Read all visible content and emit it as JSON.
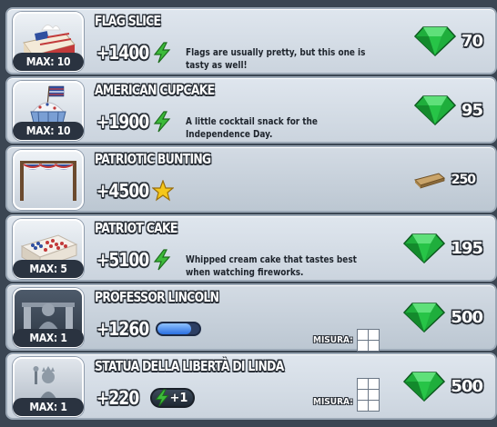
{
  "items": [
    {
      "title": "FLAG SLICE",
      "max": "MAX: 10",
      "reward": "+1400",
      "reward_icon": "lightning-bolt-icon",
      "description": "Flags are usually pretty, but this one is tasty as well!",
      "cost": "70",
      "cost_icon": "emerald-gem-icon"
    },
    {
      "title": "AMERICAN CUPCAKE",
      "max": "MAX: 10",
      "reward": "+1900",
      "reward_icon": "lightning-bolt-icon",
      "description": "A little cocktail snack for the Independence Day.",
      "cost": "95",
      "cost_icon": "emerald-gem-icon"
    },
    {
      "title": "PATRIOTIC BUNTING",
      "reward": "+4500",
      "reward_icon": "star-icon",
      "cost": "250",
      "cost_icon": "wood-plank-icon"
    },
    {
      "title": "PATRIOT CAKE",
      "max": "MAX: 5",
      "reward": "+5100",
      "reward_icon": "lightning-bolt-icon",
      "description": "Whipped cream cake that tastes best when watching fireworks.",
      "cost": "195",
      "cost_icon": "emerald-gem-icon"
    },
    {
      "title": "PROFESSOR LINCOLN",
      "max": "MAX: 1",
      "reward": "+1260",
      "reward_icon": "energy-bar-icon",
      "energy_level": 0.8,
      "size_label": "MISURA:",
      "cost": "500",
      "cost_icon": "emerald-gem-icon"
    },
    {
      "title": "STATUA DELLA LIBERTÀ DI LINDA",
      "max": "MAX: 1",
      "reward": "+220",
      "reward_icon": "lightning-bolt-icon",
      "bolt_bonus": "+1",
      "size_label": "MISURA:",
      "cost": "500",
      "cost_icon": "emerald-gem-icon"
    }
  ],
  "colors": {
    "gem_green": "#1fae3c",
    "bolt_green": "#3dbb3a",
    "star_yellow": "#f5c71a",
    "energy_blue": "#2a6fe0"
  }
}
